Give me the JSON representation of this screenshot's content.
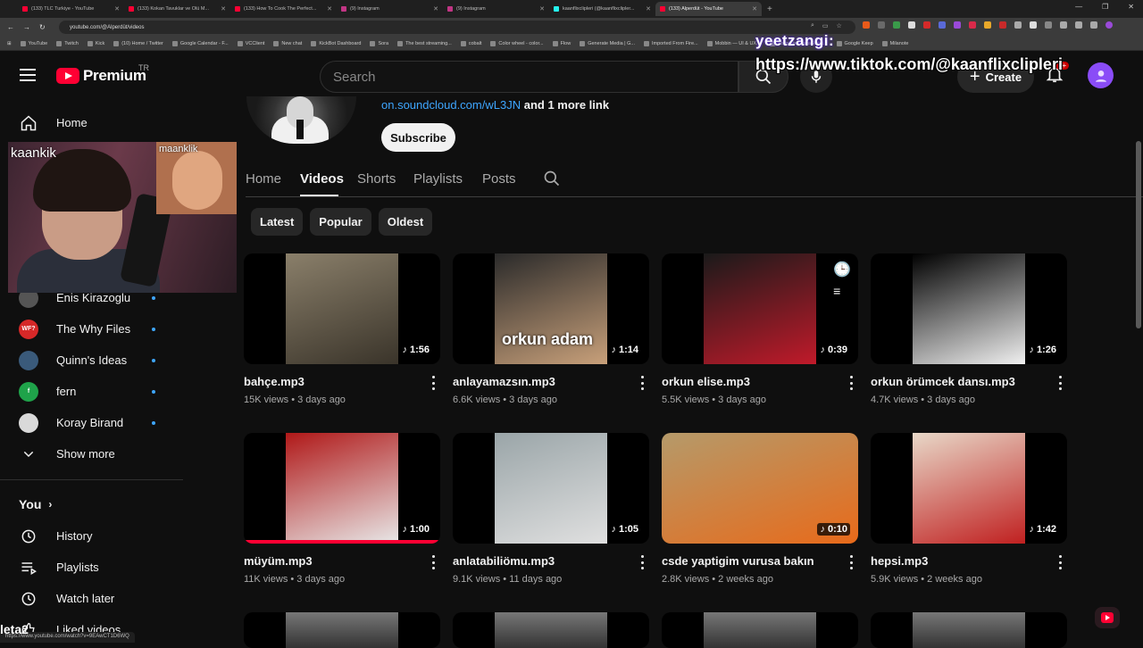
{
  "browser": {
    "tabs": [
      {
        "label": "(133) TLC Turkiye - YouTube",
        "kind": "yt"
      },
      {
        "label": "(133) Kokan Tavuklar ve Ölü M...",
        "kind": "yt"
      },
      {
        "label": "(133) How To Cook The Perfect...",
        "kind": "yt"
      },
      {
        "label": "(9) Instagram",
        "kind": "ig"
      },
      {
        "label": "(9) Instagram",
        "kind": "ig"
      },
      {
        "label": "kaanflixclipleri (@kaanflixclipler...",
        "kind": "tt"
      },
      {
        "label": "(133) Alperdüt - YouTube",
        "kind": "yt",
        "active": true
      }
    ],
    "url": "youtube.com/@Alperdüt/videos",
    "bookmarks": [
      "YouTube",
      "Twitch",
      "Kick",
      "(10) Home / Twitter",
      "Google Calendar - F...",
      "VCClient",
      "New chat",
      "KickBot Dashboard",
      "Sora",
      "The best streaming...",
      "cobalt",
      "Color wheel - color...",
      "Flow",
      "Generate Media | G...",
      "Imported From Fire...",
      "Mobbin — UI & UX...",
      "Anime.js | JavaScript...",
      "Google Keep",
      "Milanote"
    ],
    "status_url": "https://www.youtube.com/watch?v=9EAwCT1D6WQ"
  },
  "overlay": {
    "name": "yeetzangi:",
    "url": "https://www.tiktok.com/@kaanflixclipleri",
    "webcam_main": "kaankik",
    "webcam_inset": "maanklik",
    "bottom_text": "leta2"
  },
  "masthead": {
    "brand": "Premium",
    "country": "TR",
    "search_placeholder": "Search",
    "create_label": "Create",
    "notif_count": "9+"
  },
  "sidebar": {
    "home": "Home",
    "subscriptions": [
      {
        "name": "Enis Kirazoglu",
        "avatar_color": "#555555",
        "abbr": ""
      },
      {
        "name": "The Why Files",
        "avatar_color": "#d62828",
        "abbr": "WF?"
      },
      {
        "name": "Quinn's Ideas",
        "avatar_color": "#3a5a7a",
        "abbr": ""
      },
      {
        "name": "fern",
        "avatar_color": "#1fa34a",
        "abbr": "f"
      },
      {
        "name": "Koray Birand",
        "avatar_color": "#d9d9d9",
        "abbr": ""
      }
    ],
    "show_more": "Show more",
    "you": "You",
    "you_items": [
      {
        "label": "History",
        "icon": "history-icon"
      },
      {
        "label": "Playlists",
        "icon": "playlists-icon"
      },
      {
        "label": "Watch later",
        "icon": "watch-later-icon"
      },
      {
        "label": "Liked videos",
        "icon": "liked-icon"
      }
    ]
  },
  "channel": {
    "link": "on.soundcloud.com/wL3JN",
    "more_links": "and 1 more link",
    "subscribe": "Subscribe",
    "tabs": [
      "Home",
      "Videos",
      "Shorts",
      "Playlists",
      "Posts"
    ],
    "active_tab": "Videos",
    "chips": [
      "Latest",
      "Popular",
      "Oldest"
    ]
  },
  "videos": [
    {
      "title": "bahçe.mp3",
      "views": "15K views",
      "age": "3 days ago",
      "duration": "1:56",
      "thumb_a": "#8a7f6a",
      "thumb_b": "#3a342a"
    },
    {
      "title": "anlayamazsın.mp3",
      "views": "6.6K views",
      "age": "3 days ago",
      "duration": "1:14",
      "thumb_a": "#2a2a2a",
      "thumb_b": "#c8a07a",
      "caption": "orkun adam"
    },
    {
      "title": "orkun elise.mp3",
      "views": "5.5K views",
      "age": "3 days ago",
      "duration": "0:39",
      "thumb_a": "#1a1a1a",
      "thumb_b": "#c01a2a"
    },
    {
      "title": "orkun örümcek dansı.mp3",
      "views": "4.7K views",
      "age": "3 days ago",
      "duration": "1:26",
      "thumb_a": "#000000",
      "thumb_b": "#f0f0f0"
    },
    {
      "title": "müyüm.mp3",
      "views": "11K views",
      "age": "3 days ago",
      "duration": "1:00",
      "thumb_a": "#b01818",
      "thumb_b": "#e8e8e8",
      "progress": 1.0
    },
    {
      "title": "anlatabiliömu.mp3",
      "views": "9.1K views",
      "age": "11 days ago",
      "duration": "1:05",
      "thumb_a": "#9aa5a8",
      "thumb_b": "#e0e0e0"
    },
    {
      "title": "csde yaptigim vurusa bakın",
      "views": "2.8K views",
      "age": "2 weeks ago",
      "duration": "0:10",
      "thumb_a": "#b59a6a",
      "thumb_b": "#e86a1a"
    },
    {
      "title": "hepsi.mp3",
      "views": "5.9K views",
      "age": "2 weeks ago",
      "duration": "1:42",
      "thumb_a": "#e8d8c8",
      "thumb_b": "#c02020"
    }
  ]
}
